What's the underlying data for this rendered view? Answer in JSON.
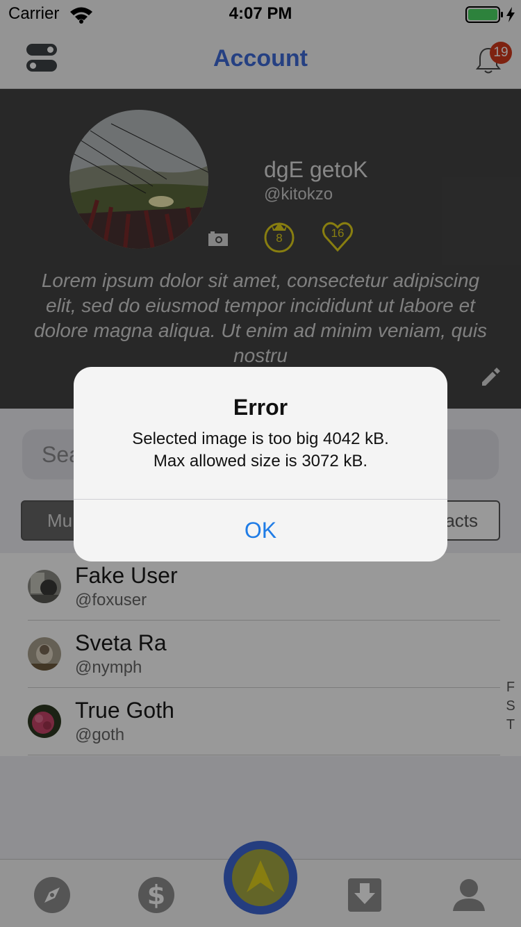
{
  "status_bar": {
    "carrier": "Carrier",
    "time": "4:07 PM"
  },
  "nav": {
    "title": "Account",
    "notification_count": "19"
  },
  "profile": {
    "display_name": "dgE getoK",
    "username": "@kitokzo",
    "crown_count": "8",
    "hearts_count": "16",
    "bio": "Lorem ipsum dolor sit amet, consectetur adipiscing elit, sed do eiusmod tempor incididunt ut labore et dolore magna aliqua. Ut enim ad minim veniam, quis nostru"
  },
  "search": {
    "placeholder_visible": "Sea"
  },
  "segments": {
    "left_visible": "Mu",
    "right_visible": "acts"
  },
  "users": [
    {
      "name": "Fake User",
      "handle": "@foxuser"
    },
    {
      "name": "Sveta Ra",
      "handle": "@nymph"
    },
    {
      "name": "True Goth",
      "handle": "@goth"
    }
  ],
  "section_index": [
    "F",
    "S",
    "T"
  ],
  "tabs": [
    "compass-icon",
    "dollar-icon",
    "navigate-icon",
    "download-icon",
    "profile-icon"
  ],
  "alert": {
    "title": "Error",
    "message_line1": "Selected image is too big 4042 kB.",
    "message_line2": "Max allowed size is 3072 kB.",
    "ok_label": "OK"
  },
  "colors": {
    "accent": "#3f6bd9",
    "badge": "#d33a1c",
    "award": "#e3d21b",
    "fab_ring": "#3d66d4",
    "alert_button": "#1f7ce6"
  }
}
